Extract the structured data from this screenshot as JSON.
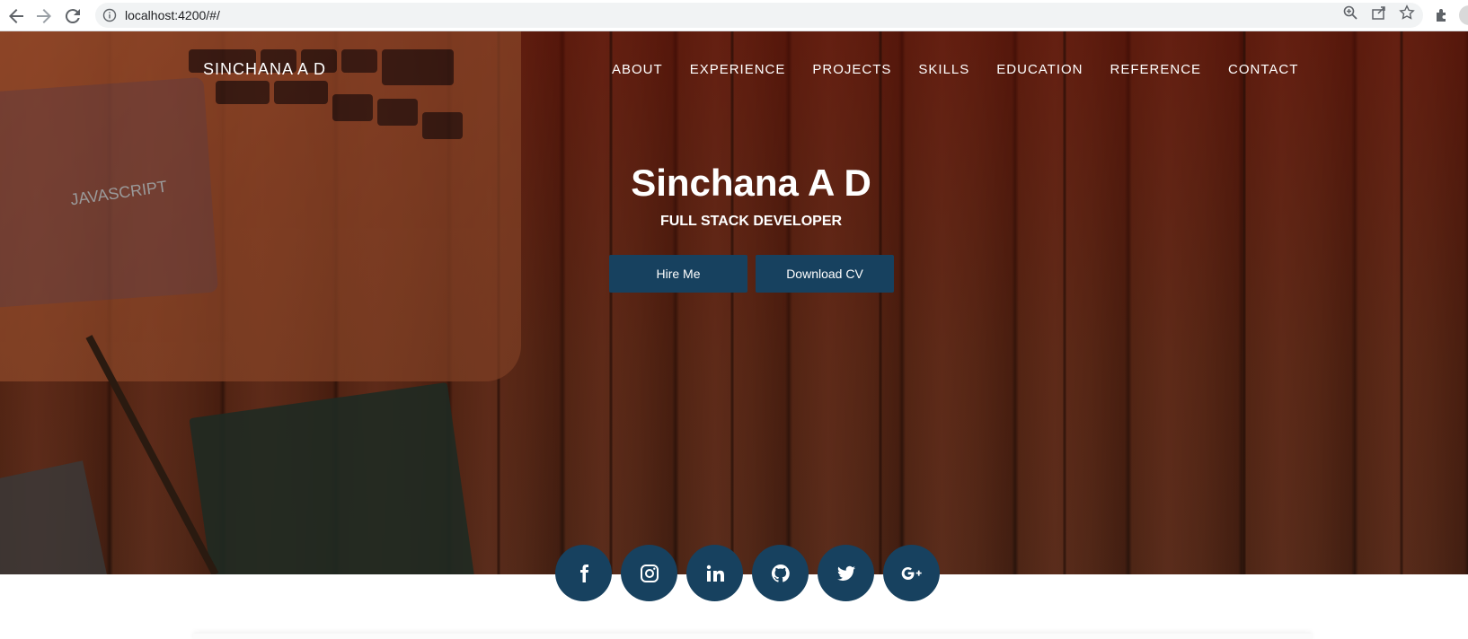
{
  "browser": {
    "url": "localhost:4200/#/",
    "back_icon": "arrow-left-icon",
    "forward_icon": "arrow-right-icon",
    "reload_icon": "reload-icon"
  },
  "header": {
    "brand": "SINCHANA A D",
    "menu": [
      "ABOUT",
      "EXPERIENCE",
      "PROJECTS",
      "SKILLS",
      "EDUCATION",
      "REFERENCE",
      "CONTACT"
    ]
  },
  "hero": {
    "name": "Sinchana A D",
    "role": "FULL STACK DEVELOPER",
    "hire_label": "Hire Me",
    "cv_label": "Download CV",
    "book_text": "JAVASCRIPT"
  },
  "socials": [
    "facebook-icon",
    "instagram-icon",
    "linkedin-icon",
    "github-icon",
    "twitter-icon",
    "google-plus-icon"
  ],
  "colors": {
    "button": "#17415f",
    "hero_overlay": "#5f0f05"
  }
}
